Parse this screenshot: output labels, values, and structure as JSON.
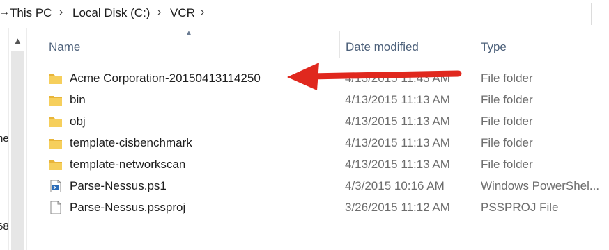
{
  "breadcrumb": {
    "items": [
      "This PC",
      "Local Disk (C:)",
      "VCR"
    ]
  },
  "left_pane": {
    "fragments": [
      "ne",
      "68"
    ]
  },
  "columns": {
    "name": "Name",
    "date_modified": "Date modified",
    "type": "Type"
  },
  "files": [
    {
      "name": "Acme Corporation-20150413114250",
      "date": "4/13/2015 11:43 AM",
      "type": "File folder",
      "icon": "folder-icon"
    },
    {
      "name": "bin",
      "date": "4/13/2015 11:13 AM",
      "type": "File folder",
      "icon": "folder-icon"
    },
    {
      "name": "obj",
      "date": "4/13/2015 11:13 AM",
      "type": "File folder",
      "icon": "folder-icon"
    },
    {
      "name": "template-cisbenchmark",
      "date": "4/13/2015 11:13 AM",
      "type": "File folder",
      "icon": "folder-icon"
    },
    {
      "name": "template-networkscan",
      "date": "4/13/2015 11:13 AM",
      "type": "File folder",
      "icon": "folder-icon"
    },
    {
      "name": "Parse-Nessus.ps1",
      "date": "4/3/2015 10:16 AM",
      "type": "Windows PowerShel...",
      "icon": "powershell-script-icon"
    },
    {
      "name": "Parse-Nessus.pssproj",
      "date": "3/26/2015 11:12 AM",
      "type": "PSSPROJ File",
      "icon": "file-icon"
    }
  ],
  "colors": {
    "arrow": "#e0281e",
    "folder": "#f2c94c",
    "header_text": "#4c607a"
  }
}
